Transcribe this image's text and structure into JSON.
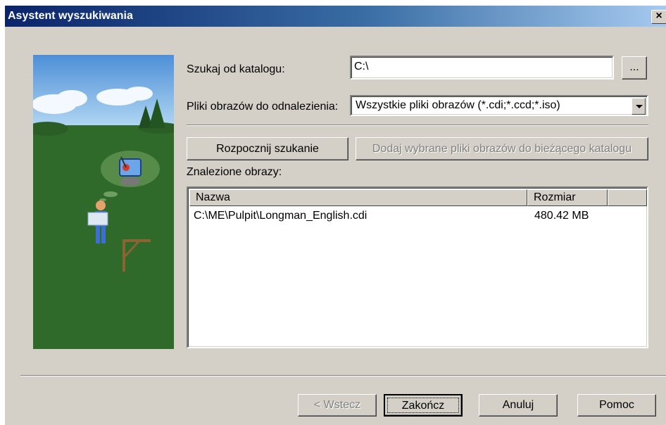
{
  "window": {
    "title": "Asystent wyszukiwania",
    "close_glyph": "×"
  },
  "search_from": {
    "label": "Szukaj od katalogu:",
    "value": "C:\\",
    "browse_label": "..."
  },
  "image_types": {
    "label": "Pliki obrazów do odnalezienia:",
    "selected": "Wszystkie pliki obrazów (*.cdi;*.ccd;*.iso)"
  },
  "actions": {
    "start_search": "Rozpocznij szukanie",
    "add_selected": "Dodaj wybrane pliki obrazów do bieżącego katalogu"
  },
  "results": {
    "label": "Znalezione obrazy:",
    "columns": [
      "Nazwa",
      "Rozmiar"
    ],
    "rows": [
      {
        "name": "C:\\ME\\Pulpit\\Longman_English.cdi",
        "size": "480.42 MB"
      }
    ]
  },
  "buttons": {
    "back": "< Wstecz",
    "finish": "Zakończ",
    "cancel": "Anuluj",
    "help": "Pomoc"
  },
  "icons": [
    "close-icon",
    "browse-icon",
    "dropdown-arrow-icon",
    "wizard-illustration",
    "computer-icon",
    "person-icon",
    "signpost-icon"
  ]
}
